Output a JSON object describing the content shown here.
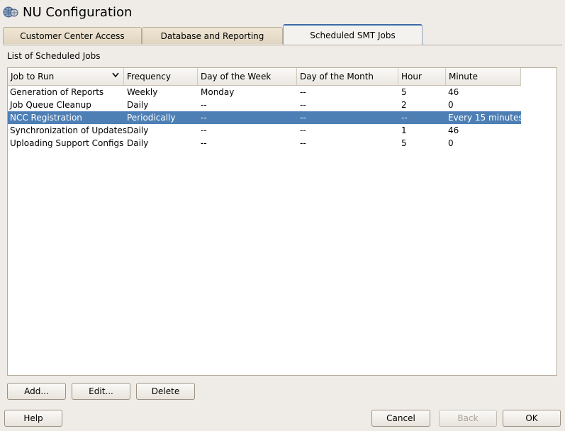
{
  "window": {
    "title": "NU Configuration",
    "icon": "globe-network-icon"
  },
  "tabs": [
    {
      "label": "Customer Center Access",
      "mnemonic": "m",
      "active": false
    },
    {
      "label": "Database and Reporting",
      "mnemonic": "D",
      "active": false
    },
    {
      "label": "Scheduled SMT Jobs",
      "mnemonic": "S",
      "active": true
    }
  ],
  "section": {
    "label": "List of Scheduled Jobs"
  },
  "table": {
    "columns": [
      "Job to Run",
      "Frequency",
      "Day of the Week",
      "Day of the Month",
      "Hour",
      "Minute"
    ],
    "rows": [
      [
        "Generation of Reports",
        "Weekly",
        "Monday",
        "--",
        "5",
        "46"
      ],
      [
        "Job Queue Cleanup",
        "Daily",
        "--",
        "--",
        "2",
        "0"
      ],
      [
        "NCC Registration",
        "Periodically",
        "--",
        "--",
        "--",
        "Every 15 minutes"
      ],
      [
        "Synchronization of Updates",
        "Daily",
        "--",
        "--",
        "1",
        "46"
      ],
      [
        "Uploading Support Configs",
        "Daily",
        "--",
        "--",
        "5",
        "0"
      ]
    ],
    "selected_row": 2,
    "sort_icon": "chevron-down-icon"
  },
  "actions": {
    "add": "Add...",
    "edit": "Edit...",
    "delete": "Delete"
  },
  "footer": {
    "help": "Help",
    "cancel": "Cancel",
    "back": "Back",
    "ok": "OK"
  },
  "colors": {
    "selection": "#4d7fb5",
    "active_tab_accent": "#3b6aa6",
    "background": "#efebe7"
  }
}
